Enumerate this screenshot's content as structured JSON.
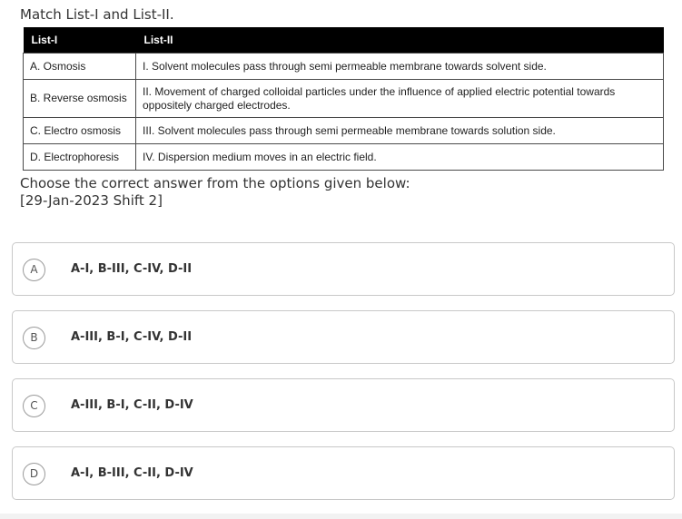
{
  "question": {
    "title": "Match List-I and List-II.",
    "instruction_line1": "Choose the correct answer from the options given below:",
    "instruction_line2": "[29-Jan-2023 Shift 2]"
  },
  "table": {
    "headers": [
      "List-I",
      "List-II"
    ],
    "rows": [
      [
        "A. Osmosis",
        "I. Solvent molecules pass through semi permeable membrane towards solvent side."
      ],
      [
        "B. Reverse osmosis",
        "II. Movement of charged colloidal particles under the influence of applied electric potential towards oppositely charged electrodes."
      ],
      [
        "C. Electro osmosis",
        "III. Solvent molecules pass through semi permeable membrane towards solution side."
      ],
      [
        "D. Electrophoresis",
        "IV. Dispersion medium moves in an electric field."
      ]
    ]
  },
  "options": [
    {
      "letter": "A",
      "text": "A-I, B-III, C-IV, D-II"
    },
    {
      "letter": "B",
      "text": "A-III, B-I, C-IV, D-II"
    },
    {
      "letter": "C",
      "text": "A-III, B-I, C-II, D-IV"
    },
    {
      "letter": "D",
      "text": "A-I, B-III, C-II, D-IV"
    }
  ]
}
